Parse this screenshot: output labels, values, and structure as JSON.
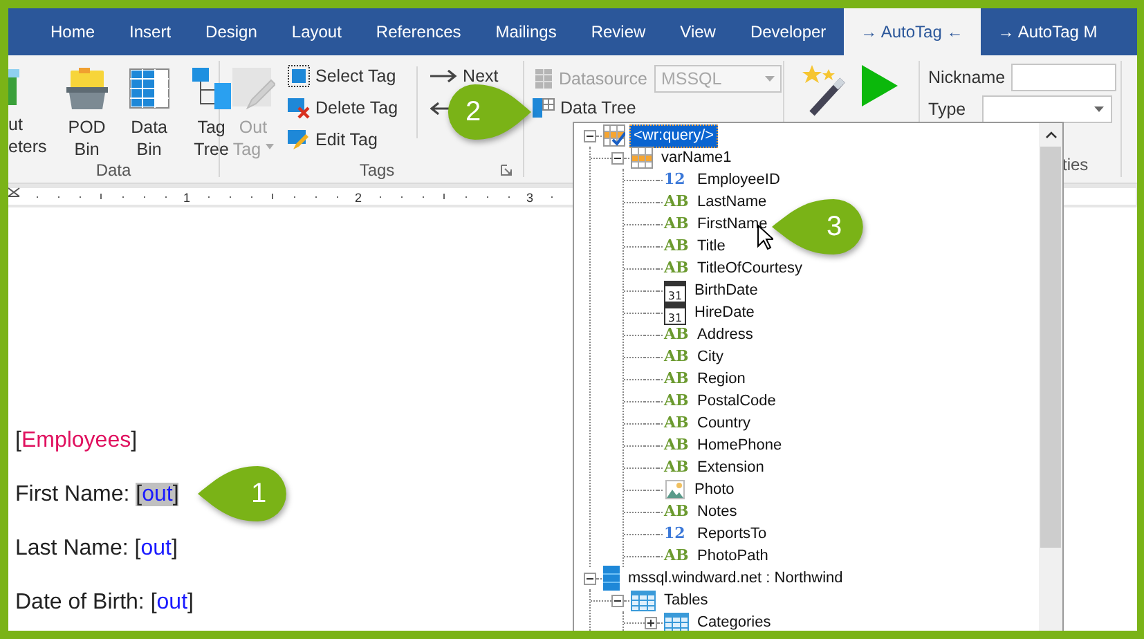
{
  "ribbon_tabs": [
    {
      "label": "Home",
      "selected": false
    },
    {
      "label": "Insert",
      "selected": false
    },
    {
      "label": "Design",
      "selected": false
    },
    {
      "label": "Layout",
      "selected": false
    },
    {
      "label": "References",
      "selected": false
    },
    {
      "label": "Mailings",
      "selected": false
    },
    {
      "label": "Review",
      "selected": false
    },
    {
      "label": "View",
      "selected": false
    },
    {
      "label": "Developer",
      "selected": false
    },
    {
      "label": "→ AutoTag ←",
      "selected": true
    },
    {
      "label": "→ AutoTag M",
      "selected": false
    }
  ],
  "data_group": {
    "label": "Data",
    "buttons": [
      {
        "lines": [
          "ut",
          "eters"
        ],
        "kind": "form"
      },
      {
        "lines": [
          "POD",
          "Bin"
        ],
        "kind": "folder"
      },
      {
        "lines": [
          "Data",
          "Bin"
        ],
        "kind": "grid"
      },
      {
        "lines": [
          "Tag",
          "Tree"
        ],
        "kind": "tree"
      }
    ]
  },
  "tags_group": {
    "label": "Tags",
    "out_tag": {
      "lines": [
        "Out",
        "Tag"
      ],
      "disabled": true
    },
    "tag_buttons": [
      {
        "label": "Select Tag",
        "kind": "select"
      },
      {
        "label": "Delete Tag",
        "kind": "delete"
      },
      {
        "label": "Edit Tag",
        "kind": "edit"
      }
    ],
    "nav_buttons": [
      {
        "label": "Next",
        "kind": "next"
      },
      {
        "kind": "previous"
      }
    ]
  },
  "datasource_group": {
    "datasource": {
      "label": "Datasource",
      "value": "MSSQL",
      "disabled": true
    },
    "data_tree": {
      "label": "Data Tree"
    }
  },
  "properties_group": {
    "label": "ties",
    "nickname": {
      "label": "Nickname"
    },
    "type": {
      "label": "Type"
    }
  },
  "ruler": {
    "numbers": [
      "1",
      "2",
      "3"
    ]
  },
  "document": {
    "lines": [
      {
        "tag": {
          "open": "[",
          "text": "Employees",
          "close": "]",
          "kind": "block",
          "highlighted": false
        }
      },
      {
        "label": "First Name: ",
        "tag": {
          "open": "[",
          "text": "out",
          "close": "]",
          "kind": "out",
          "highlighted": true
        }
      },
      {
        "label": "Last Name: ",
        "tag": {
          "open": "[",
          "text": "out",
          "close": "]",
          "kind": "out",
          "highlighted": false
        }
      },
      {
        "label": "Date of Birth: ",
        "tag": {
          "open": "[",
          "text": "out",
          "close": "]",
          "kind": "out",
          "highlighted": false
        }
      }
    ]
  },
  "data_tree": {
    "nodes": [
      {
        "label": "<wr:query/>",
        "kind": "query",
        "expanded": true,
        "selected": true,
        "children": [
          {
            "label": "varName1",
            "kind": "table",
            "expanded": true,
            "selected": false,
            "children": [
              {
                "label": "EmployeeID",
                "kind": "number",
                "icon_text": "12",
                "selected": false
              },
              {
                "label": "LastName",
                "kind": "text",
                "icon_text": "AB",
                "selected": false
              },
              {
                "label": "FirstName",
                "kind": "text",
                "icon_text": "AB",
                "selected": false
              },
              {
                "label": "Title",
                "kind": "text",
                "icon_text": "AB",
                "selected": false
              },
              {
                "label": "TitleOfCourtesy",
                "kind": "text",
                "icon_text": "AB",
                "selected": false
              },
              {
                "label": "BirthDate",
                "kind": "date",
                "icon_text": "31",
                "selected": false
              },
              {
                "label": "HireDate",
                "kind": "date",
                "icon_text": "31",
                "selected": false
              },
              {
                "label": "Address",
                "kind": "text",
                "icon_text": "AB",
                "selected": false
              },
              {
                "label": "City",
                "kind": "text",
                "icon_text": "AB",
                "selected": false
              },
              {
                "label": "Region",
                "kind": "text",
                "icon_text": "AB",
                "selected": false
              },
              {
                "label": "PostalCode",
                "kind": "text",
                "icon_text": "AB",
                "selected": false
              },
              {
                "label": "Country",
                "kind": "text",
                "icon_text": "AB",
                "selected": false
              },
              {
                "label": "HomePhone",
                "kind": "text",
                "icon_text": "AB",
                "selected": false
              },
              {
                "label": "Extension",
                "kind": "text",
                "icon_text": "AB",
                "selected": false
              },
              {
                "label": "Photo",
                "kind": "image",
                "selected": false
              },
              {
                "label": "Notes",
                "kind": "text",
                "icon_text": "AB",
                "selected": false
              },
              {
                "label": "ReportsTo",
                "kind": "number",
                "icon_text": "12",
                "selected": false
              },
              {
                "label": "PhotoPath",
                "kind": "text",
                "icon_text": "AB",
                "selected": false
              }
            ]
          }
        ]
      },
      {
        "label": "mssql.windward.net : Northwind",
        "kind": "database",
        "expanded": true,
        "selected": false,
        "children": [
          {
            "label": "Tables",
            "kind": "tables",
            "expanded": true,
            "selected": false,
            "children": [
              {
                "label": "Categories",
                "kind": "tables",
                "expanded": false,
                "selected": false
              }
            ]
          }
        ]
      }
    ]
  },
  "callouts": [
    {
      "number": "2"
    },
    {
      "number": "3"
    },
    {
      "number": "1"
    }
  ]
}
